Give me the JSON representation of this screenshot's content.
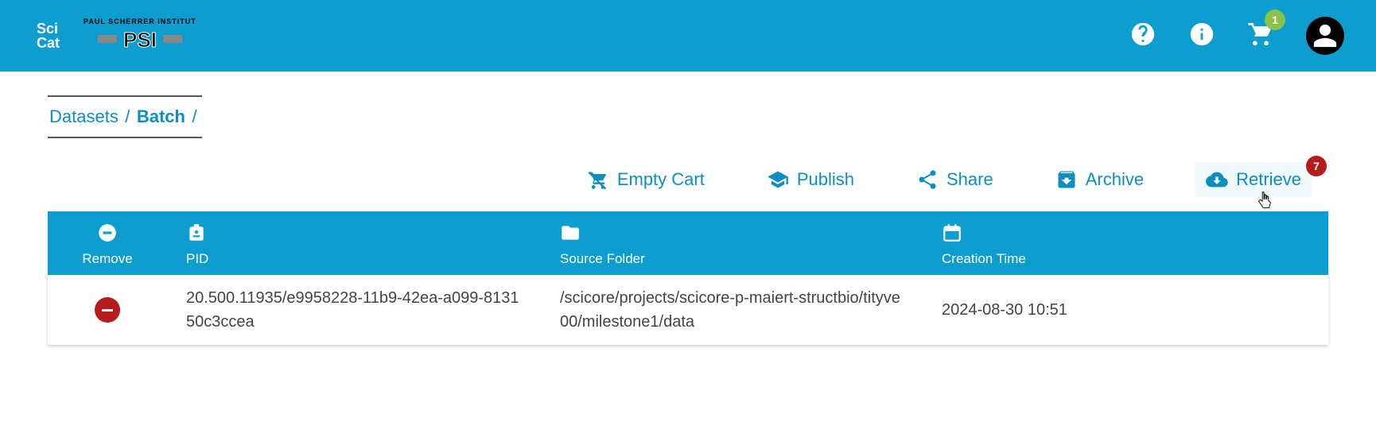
{
  "header": {
    "cart_badge": "1"
  },
  "breadcrumb": {
    "datasets": "Datasets",
    "batch": "Batch"
  },
  "toolbar": {
    "empty_cart": "Empty Cart",
    "publish": "Publish",
    "share": "Share",
    "archive": "Archive",
    "retrieve": "Retrieve",
    "retrieve_badge": "7"
  },
  "table": {
    "headers": {
      "remove": "Remove",
      "pid": "PID",
      "source": "Source Folder",
      "time": "Creation Time"
    },
    "rows": [
      {
        "pid": "20.500.11935/e9958228-11b9-42ea-a099-813150c3ccea",
        "source": "/scicore/projects/scicore-p-maiert-structbio/tityve00/milestone1/data",
        "time": "2024-08-30 10:51"
      }
    ]
  }
}
